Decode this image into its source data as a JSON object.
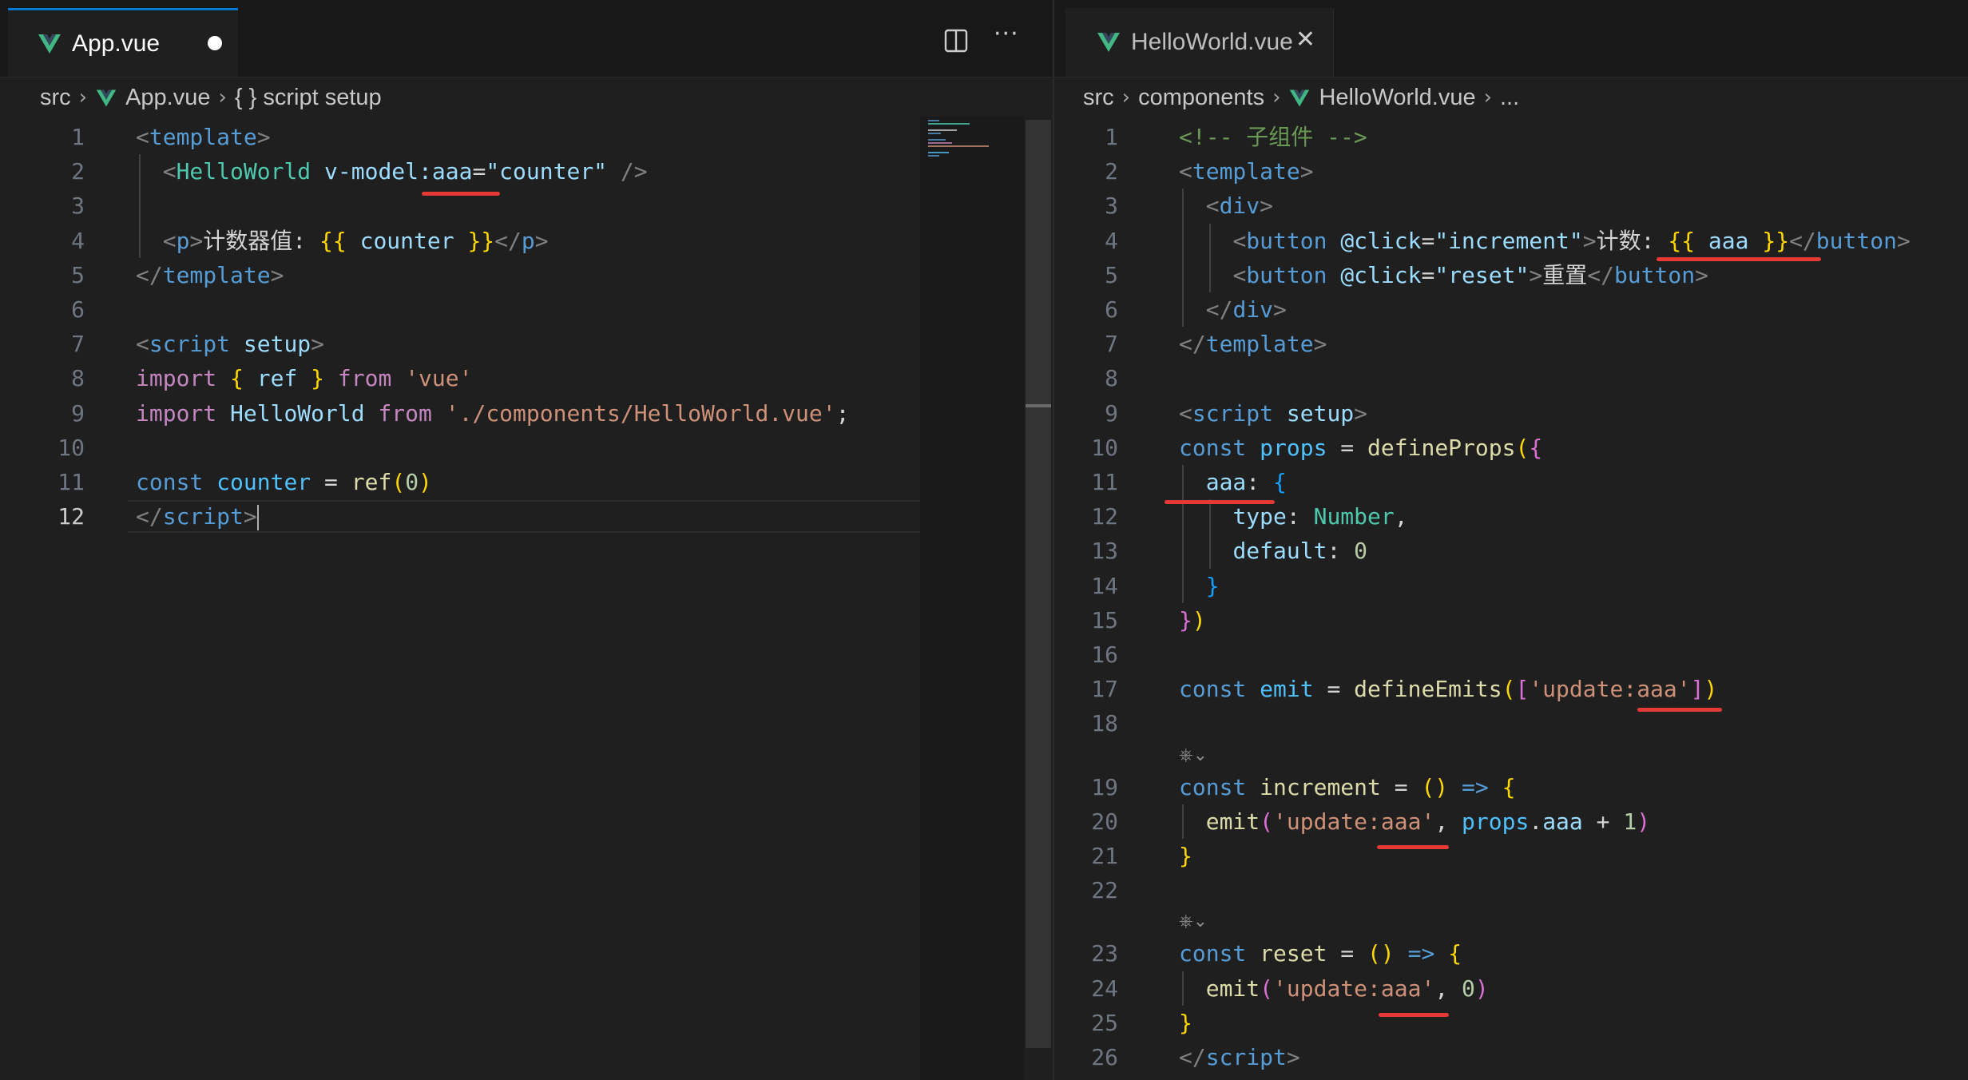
{
  "left_pane": {
    "tab": {
      "title": "App.vue",
      "icon": "vue-icon",
      "dirty": true
    },
    "actions": {
      "split_icon": "split-editor-icon",
      "more_label": "···"
    },
    "breadcrumb": [
      "src",
      "App.vue",
      "{ } script setup"
    ],
    "active_line": "12",
    "lines": [
      {
        "n": "1",
        "tokens": [
          [
            "<",
            "c-bracket"
          ],
          [
            "template",
            "c-tag"
          ],
          [
            ">",
            "c-bracket"
          ]
        ]
      },
      {
        "n": "2",
        "tokens": [
          [
            "  ",
            "c-plain"
          ],
          [
            "<",
            "c-bracket"
          ],
          [
            "HelloWorld",
            "c-comp"
          ],
          [
            " ",
            "c-plain"
          ],
          [
            "v-model:aaa",
            "c-attr"
          ],
          [
            "=",
            "c-plain"
          ],
          [
            "\"counter\"",
            "c-attr"
          ],
          [
            " />",
            "c-bracket"
          ]
        ]
      },
      {
        "n": "3",
        "tokens": []
      },
      {
        "n": "4",
        "tokens": [
          [
            "  ",
            "c-plain"
          ],
          [
            "<",
            "c-bracket"
          ],
          [
            "p",
            "c-tag"
          ],
          [
            ">",
            "c-bracket"
          ],
          [
            "计数器值: ",
            "c-text"
          ],
          [
            "{{",
            "c-b1"
          ],
          [
            " counter ",
            "c-attr"
          ],
          [
            "}}",
            "c-b1"
          ],
          [
            "</",
            "c-bracket"
          ],
          [
            "p",
            "c-tag"
          ],
          [
            ">",
            "c-bracket"
          ]
        ]
      },
      {
        "n": "5",
        "tokens": [
          [
            "</",
            "c-bracket"
          ],
          [
            "template",
            "c-tag"
          ],
          [
            ">",
            "c-bracket"
          ]
        ]
      },
      {
        "n": "6",
        "tokens": []
      },
      {
        "n": "7",
        "tokens": [
          [
            "<",
            "c-bracket"
          ],
          [
            "script",
            "c-tag"
          ],
          [
            " ",
            "c-plain"
          ],
          [
            "setup",
            "c-attr"
          ],
          [
            ">",
            "c-bracket"
          ]
        ]
      },
      {
        "n": "8",
        "tokens": [
          [
            "import",
            "c-ctrl"
          ],
          [
            " ",
            "c-plain"
          ],
          [
            "{",
            "c-b1"
          ],
          [
            " ref ",
            "c-attr"
          ],
          [
            "}",
            "c-b1"
          ],
          [
            " ",
            "c-plain"
          ],
          [
            "from",
            "c-ctrl"
          ],
          [
            " ",
            "c-plain"
          ],
          [
            "'vue'",
            "c-str"
          ]
        ]
      },
      {
        "n": "9",
        "tokens": [
          [
            "import",
            "c-ctrl"
          ],
          [
            " ",
            "c-plain"
          ],
          [
            "HelloWorld",
            "c-attr"
          ],
          [
            " ",
            "c-plain"
          ],
          [
            "from",
            "c-ctrl"
          ],
          [
            " ",
            "c-plain"
          ],
          [
            "'./components/HelloWorld.vue'",
            "c-str"
          ],
          [
            ";",
            "c-plain"
          ]
        ]
      },
      {
        "n": "10",
        "tokens": []
      },
      {
        "n": "11",
        "tokens": [
          [
            "const",
            "c-kw"
          ],
          [
            " ",
            "c-plain"
          ],
          [
            "counter",
            "c-var"
          ],
          [
            " = ",
            "c-plain"
          ],
          [
            "ref",
            "c-fn"
          ],
          [
            "(",
            "c-b1"
          ],
          [
            "0",
            "c-num"
          ],
          [
            ")",
            "c-b1"
          ]
        ]
      },
      {
        "n": "12",
        "tokens": [
          [
            "</",
            "c-bracket"
          ],
          [
            "script",
            "c-tag"
          ],
          [
            ">",
            "c-bracket"
          ]
        ]
      }
    ]
  },
  "right_pane": {
    "tab": {
      "title": "HelloWorld.vue",
      "icon": "vue-icon",
      "close_label": "✕"
    },
    "breadcrumb": [
      "src",
      "components",
      "HelloWorld.vue",
      "..."
    ],
    "lines": [
      {
        "n": "1",
        "tokens": [
          [
            "<!-- 子组件 -->",
            "c-comment"
          ]
        ]
      },
      {
        "n": "2",
        "tokens": [
          [
            "<",
            "c-bracket"
          ],
          [
            "template",
            "c-tag"
          ],
          [
            ">",
            "c-bracket"
          ]
        ]
      },
      {
        "n": "3",
        "tokens": [
          [
            "  ",
            "c-plain"
          ],
          [
            "<",
            "c-bracket"
          ],
          [
            "div",
            "c-tag"
          ],
          [
            ">",
            "c-bracket"
          ]
        ]
      },
      {
        "n": "4",
        "tokens": [
          [
            "    ",
            "c-plain"
          ],
          [
            "<",
            "c-bracket"
          ],
          [
            "button",
            "c-tag"
          ],
          [
            " ",
            "c-plain"
          ],
          [
            "@click",
            "c-attr"
          ],
          [
            "=",
            "c-plain"
          ],
          [
            "\"increment\"",
            "c-attr"
          ],
          [
            ">",
            "c-bracket"
          ],
          [
            "计数: ",
            "c-text"
          ],
          [
            "{{",
            "c-b1"
          ],
          [
            " aaa ",
            "c-attr"
          ],
          [
            "}}",
            "c-b1"
          ],
          [
            "</",
            "c-bracket"
          ],
          [
            "button",
            "c-tag"
          ],
          [
            ">",
            "c-bracket"
          ]
        ]
      },
      {
        "n": "5",
        "tokens": [
          [
            "    ",
            "c-plain"
          ],
          [
            "<",
            "c-bracket"
          ],
          [
            "button",
            "c-tag"
          ],
          [
            " ",
            "c-plain"
          ],
          [
            "@click",
            "c-attr"
          ],
          [
            "=",
            "c-plain"
          ],
          [
            "\"reset\"",
            "c-attr"
          ],
          [
            ">",
            "c-bracket"
          ],
          [
            "重置",
            "c-text"
          ],
          [
            "</",
            "c-bracket"
          ],
          [
            "button",
            "c-tag"
          ],
          [
            ">",
            "c-bracket"
          ]
        ]
      },
      {
        "n": "6",
        "tokens": [
          [
            "  ",
            "c-plain"
          ],
          [
            "</",
            "c-bracket"
          ],
          [
            "div",
            "c-tag"
          ],
          [
            ">",
            "c-bracket"
          ]
        ]
      },
      {
        "n": "7",
        "tokens": [
          [
            "</",
            "c-bracket"
          ],
          [
            "template",
            "c-tag"
          ],
          [
            ">",
            "c-bracket"
          ]
        ]
      },
      {
        "n": "8",
        "tokens": []
      },
      {
        "n": "9",
        "tokens": [
          [
            "<",
            "c-bracket"
          ],
          [
            "script",
            "c-tag"
          ],
          [
            " ",
            "c-plain"
          ],
          [
            "setup",
            "c-attr"
          ],
          [
            ">",
            "c-bracket"
          ]
        ]
      },
      {
        "n": "10",
        "tokens": [
          [
            "const",
            "c-kw"
          ],
          [
            " ",
            "c-plain"
          ],
          [
            "props",
            "c-var"
          ],
          [
            " = ",
            "c-plain"
          ],
          [
            "defineProps",
            "c-fn"
          ],
          [
            "(",
            "c-b1"
          ],
          [
            "{",
            "c-b2"
          ]
        ]
      },
      {
        "n": "11",
        "tokens": [
          [
            "  ",
            "c-plain"
          ],
          [
            "aaa",
            "c-prop"
          ],
          [
            ": ",
            "c-plain"
          ],
          [
            "{",
            "c-b3"
          ]
        ]
      },
      {
        "n": "12",
        "tokens": [
          [
            "    ",
            "c-plain"
          ],
          [
            "type",
            "c-prop"
          ],
          [
            ": ",
            "c-plain"
          ],
          [
            "Number",
            "c-type"
          ],
          [
            ",",
            "c-plain"
          ]
        ]
      },
      {
        "n": "13",
        "tokens": [
          [
            "    ",
            "c-plain"
          ],
          [
            "default",
            "c-prop"
          ],
          [
            ": ",
            "c-plain"
          ],
          [
            "0",
            "c-num"
          ]
        ]
      },
      {
        "n": "14",
        "tokens": [
          [
            "  ",
            "c-plain"
          ],
          [
            "}",
            "c-b3"
          ]
        ]
      },
      {
        "n": "15",
        "tokens": [
          [
            "}",
            "c-b2"
          ],
          [
            ")",
            "c-b1"
          ]
        ]
      },
      {
        "n": "16",
        "tokens": []
      },
      {
        "n": "17",
        "tokens": [
          [
            "const",
            "c-kw"
          ],
          [
            " ",
            "c-plain"
          ],
          [
            "emit",
            "c-var"
          ],
          [
            " = ",
            "c-plain"
          ],
          [
            "defineEmits",
            "c-fn"
          ],
          [
            "(",
            "c-b1"
          ],
          [
            "[",
            "c-b2"
          ],
          [
            "'update:aaa'",
            "c-str"
          ],
          [
            "]",
            "c-b2"
          ],
          [
            ")",
            "c-b1"
          ]
        ]
      },
      {
        "n": "18",
        "tokens": []
      },
      {
        "n": "",
        "fold": "⎈⌄",
        "tokens": []
      },
      {
        "n": "19",
        "tokens": [
          [
            "const",
            "c-kw"
          ],
          [
            " ",
            "c-plain"
          ],
          [
            "increment",
            "c-fn"
          ],
          [
            " = ",
            "c-plain"
          ],
          [
            "()",
            "c-b1"
          ],
          [
            " ",
            "c-plain"
          ],
          [
            "=>",
            "c-kw"
          ],
          [
            " ",
            "c-plain"
          ],
          [
            "{",
            "c-b1"
          ]
        ]
      },
      {
        "n": "20",
        "tokens": [
          [
            "  ",
            "c-plain"
          ],
          [
            "emit",
            "c-fn"
          ],
          [
            "(",
            "c-b2"
          ],
          [
            "'update:aaa'",
            "c-str"
          ],
          [
            ", ",
            "c-plain"
          ],
          [
            "props",
            "c-var"
          ],
          [
            ".",
            "c-plain"
          ],
          [
            "aaa",
            "c-prop"
          ],
          [
            " + ",
            "c-plain"
          ],
          [
            "1",
            "c-num"
          ],
          [
            ")",
            "c-b2"
          ]
        ]
      },
      {
        "n": "21",
        "tokens": [
          [
            "}",
            "c-b1"
          ]
        ]
      },
      {
        "n": "22",
        "tokens": []
      },
      {
        "n": "",
        "fold": "⎈⌄",
        "tokens": []
      },
      {
        "n": "23",
        "tokens": [
          [
            "const",
            "c-kw"
          ],
          [
            " ",
            "c-plain"
          ],
          [
            "reset",
            "c-fn"
          ],
          [
            " = ",
            "c-plain"
          ],
          [
            "()",
            "c-b1"
          ],
          [
            " ",
            "c-plain"
          ],
          [
            "=>",
            "c-kw"
          ],
          [
            " ",
            "c-plain"
          ],
          [
            "{",
            "c-b1"
          ]
        ]
      },
      {
        "n": "24",
        "tokens": [
          [
            "  ",
            "c-plain"
          ],
          [
            "emit",
            "c-fn"
          ],
          [
            "(",
            "c-b2"
          ],
          [
            "'update:aaa'",
            "c-str"
          ],
          [
            ", ",
            "c-plain"
          ],
          [
            "0",
            "c-num"
          ],
          [
            ")",
            "c-b2"
          ]
        ]
      },
      {
        "n": "25",
        "tokens": [
          [
            "}",
            "c-b1"
          ]
        ]
      },
      {
        "n": "26",
        "tokens": [
          [
            "</",
            "c-bracket"
          ],
          [
            "script",
            "c-tag"
          ],
          [
            ">",
            "c-bracket"
          ]
        ]
      }
    ]
  },
  "colors": {
    "accent": "#0078d4",
    "annotation": "#e53935",
    "vue_green": "#41b883"
  }
}
